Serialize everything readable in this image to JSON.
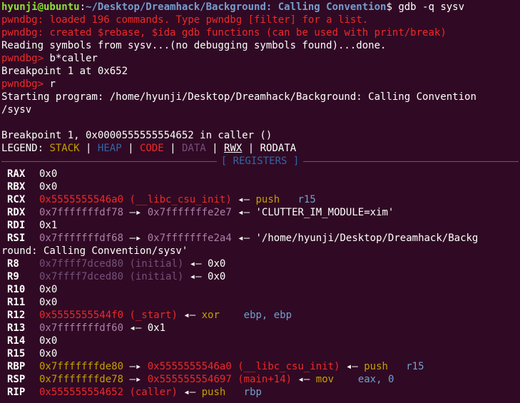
{
  "prompt": {
    "user_host": "hyunji@ubuntu",
    "sep": ":",
    "path": "~/Desktop/Dreamhack/Background: Calling Convention",
    "symbol": "$",
    "command": "gdb -q sysv"
  },
  "pwndbg_lines": [
    {
      "prefix": "pwndbg:",
      "text": "loaded 196 commands. Type pwndbg [filter] for a list."
    },
    {
      "prefix": "pwndbg:",
      "text": "created $rebase, $ida gdb functions (can be used with print/break)"
    }
  ],
  "reading": "Reading symbols from sysv...(no debugging symbols found)...done.",
  "gdb_prompt": "pwndbg>",
  "cmd1": "b*caller",
  "bp_set": "Breakpoint 1 at 0x652",
  "cmd2": "r",
  "starting1": "Starting program: /home/hyunji/Desktop/Dreamhack/Background: Calling Convention",
  "starting2": "/sysv",
  "bp_hit": "Breakpoint 1, 0x0000555555554652 in caller ()",
  "legend": {
    "label": "LEGEND:",
    "stack": "STACK",
    "heap": "HEAP",
    "code": "CODE",
    "data": "DATA",
    "rwx": "RWX",
    "rodata": "RODATA",
    "sep": "|"
  },
  "registers_title": "[ REGISTERS ]",
  "arrow": "◂—",
  "arrow_right": "—▸",
  "registers": {
    "rax": {
      "name": "RAX",
      "value": "0x0"
    },
    "rbx": {
      "name": "RBX",
      "value": "0x0"
    },
    "rcx": {
      "name": "RCX",
      "addr": "0x5555555546a0",
      "sym": "(__libc_csu_init)",
      "ins": "push",
      "op": "r15"
    },
    "rdx": {
      "name": "RDX",
      "addr": "0x7fffffffdf78",
      "addr2": "0x7fffffffe2e7",
      "str": "'CLUTTER_IM_MODULE=xim'"
    },
    "rdi": {
      "name": "RDI",
      "value": "0x1"
    },
    "rsi": {
      "name": "RSI",
      "addr": "0x7fffffffdf68",
      "addr2": "0x7fffffffe2a4",
      "str1": "'/home/hyunji/Desktop/Dreamhack/Backg",
      "str2": "round: Calling Convention/sysv'"
    },
    "r8": {
      "name": "R8",
      "addr": "0x7ffff7dced80",
      "sym": "(initial)",
      "value": "0x0"
    },
    "r9": {
      "name": "R9",
      "addr": "0x7ffff7dced80",
      "sym": "(initial)",
      "value": "0x0"
    },
    "r10": {
      "name": "R10",
      "value": "0x0"
    },
    "r11": {
      "name": "R11",
      "value": "0x0"
    },
    "r12": {
      "name": "R12",
      "addr": "0x5555555544f0",
      "sym": "(_start)",
      "ins": "xor",
      "op": "ebp, ebp"
    },
    "r13": {
      "name": "R13",
      "addr": "0x7fffffffdf60",
      "value": "0x1"
    },
    "r14": {
      "name": "R14",
      "value": "0x0"
    },
    "r15": {
      "name": "R15",
      "value": "0x0"
    },
    "rbp": {
      "name": "RBP",
      "addr": "0x7fffffffde80",
      "addr2": "0x5555555546a0",
      "sym": "(__libc_csu_init)",
      "ins": "push",
      "op": "r15"
    },
    "rsp": {
      "name": "RSP",
      "addr": "0x7fffffffde78",
      "addr2": "0x555555554697",
      "sym": "(main+14)",
      "ins": "mov",
      "op1": "eax,",
      "op2": "0"
    },
    "rip": {
      "name": "RIP",
      "addr": "0x555555554652",
      "sym": "(caller)",
      "ins": "push",
      "op": "rbp"
    }
  }
}
